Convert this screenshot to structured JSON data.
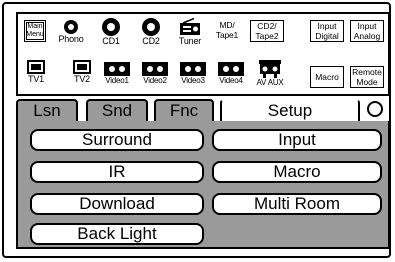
{
  "sources_row1": [
    {
      "label": "Main\nMenu",
      "icon": "main-menu-box"
    },
    {
      "label": "Phono",
      "icon": "disc-icon"
    },
    {
      "label": "CD1",
      "icon": "disc-icon"
    },
    {
      "label": "CD2",
      "icon": "disc-icon"
    },
    {
      "label": "Tuner",
      "icon": "radio-icon"
    },
    {
      "label": "MD/\nTape1",
      "icon": "text"
    },
    {
      "label": "CD2/\nTape2",
      "icon": "box"
    },
    {
      "label": "Input\nDigital",
      "icon": "box"
    },
    {
      "label": "Input\nAnalog",
      "icon": "box"
    }
  ],
  "sources_row2": [
    {
      "label": "TV1",
      "icon": "tv-icon"
    },
    {
      "label": "TV2",
      "icon": "tv-icon"
    },
    {
      "label": "Video1",
      "icon": "tape-icon"
    },
    {
      "label": "Video2",
      "icon": "tape-icon"
    },
    {
      "label": "Video3",
      "icon": "tape-icon"
    },
    {
      "label": "Video4",
      "icon": "tape-icon"
    },
    {
      "label": "AV AUX",
      "icon": "av-aux-icon"
    },
    {
      "label": "Macro",
      "icon": "box"
    },
    {
      "label": "Remote\nMode",
      "icon": "box"
    }
  ],
  "tabs": [
    "Lsn",
    "Snd",
    "Fnc",
    "Setup"
  ],
  "active_tab": "Setup",
  "setup_buttons": [
    "Surround",
    "Input",
    "IR",
    "Macro",
    "Download",
    "Multi Room",
    "Back Light"
  ]
}
